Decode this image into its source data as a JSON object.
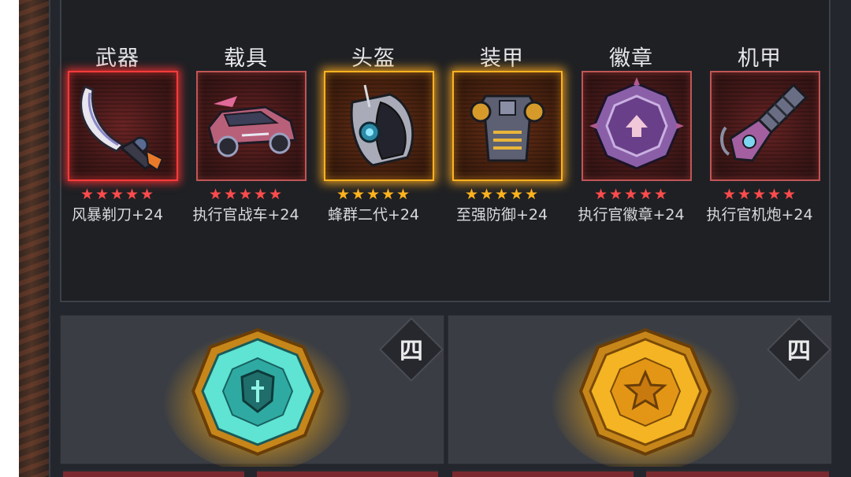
{
  "slots": [
    {
      "title": "武器",
      "name": "风暴剃刀+24",
      "stars": 5,
      "star_color": "#ff4b4b",
      "frame": "red",
      "icon": "blade-icon"
    },
    {
      "title": "载具",
      "name": "执行官战车+24",
      "stars": 5,
      "star_color": "#ff4b4b",
      "frame": "dim",
      "icon": "vehicle-icon"
    },
    {
      "title": "头盔",
      "name": "蜂群二代+24",
      "stars": 5,
      "star_color": "#ffb21e",
      "frame": "gold",
      "icon": "helmet-icon"
    },
    {
      "title": "装甲",
      "name": "至强防御+24",
      "stars": 5,
      "star_color": "#ffb21e",
      "frame": "gold",
      "icon": "armor-icon"
    },
    {
      "title": "徽章",
      "name": "执行官徽章+24",
      "stars": 5,
      "star_color": "#ff4b4b",
      "frame": "dim",
      "icon": "badge-icon"
    },
    {
      "title": "机甲",
      "name": "执行官机炮+24",
      "stars": 5,
      "star_color": "#ff4b4b",
      "frame": "dim",
      "icon": "cannon-icon"
    }
  ],
  "gems": [
    {
      "tier": "四",
      "color": "#39d3c4",
      "icon": "cyan-shield-gem-icon"
    },
    {
      "tier": "四",
      "color": "#f1a81d",
      "icon": "gold-star-gem-icon"
    }
  ],
  "star_glyph": "★"
}
